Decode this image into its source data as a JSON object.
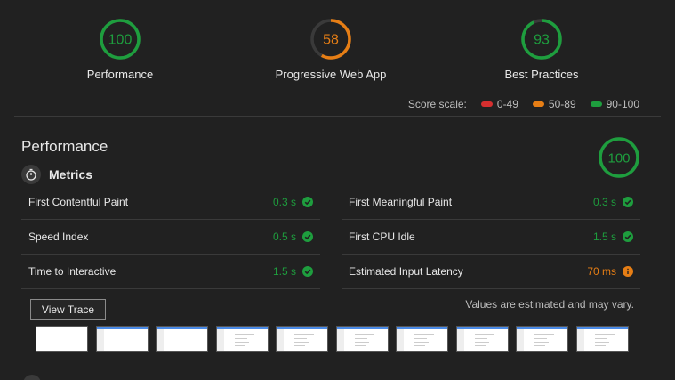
{
  "colors": {
    "pass": "#1e9e3e",
    "average": "#e67e15",
    "fail": "#d62f2f",
    "track": "#3a3a3a"
  },
  "gauges": [
    {
      "score": "100",
      "label": "Performance",
      "fraction": 1.0,
      "color": "#1e9e3e"
    },
    {
      "score": "58",
      "label": "Progressive Web App",
      "fraction": 0.58,
      "color": "#e67e15"
    },
    {
      "score": "93",
      "label": "Best Practices",
      "fraction": 0.93,
      "color": "#1e9e3e"
    }
  ],
  "scale": {
    "label": "Score scale:",
    "ranges": [
      {
        "text": "0-49",
        "color": "#d62f2f"
      },
      {
        "text": "50-89",
        "color": "#e67e15"
      },
      {
        "text": "90-100",
        "color": "#1e9e3e"
      }
    ]
  },
  "performance": {
    "title": "Performance",
    "score": "100",
    "fraction": 1.0
  },
  "metrics": {
    "title": "Metrics",
    "icon": "stopwatch-icon",
    "items": [
      {
        "label": "First Contentful Paint",
        "value": "0.3 s",
        "status": "pass"
      },
      {
        "label": "First Meaningful Paint",
        "value": "0.3 s",
        "status": "pass"
      },
      {
        "label": "Speed Index",
        "value": "0.5 s",
        "status": "pass"
      },
      {
        "label": "First CPU Idle",
        "value": "1.5 s",
        "status": "pass"
      },
      {
        "label": "Time to Interactive",
        "value": "1.5 s",
        "status": "pass"
      },
      {
        "label": "Estimated Input Latency",
        "value": "70 ms",
        "status": "average"
      }
    ]
  },
  "trace": {
    "button_label": "View Trace",
    "note": "Values are estimated and may vary."
  },
  "filmstrip": {
    "frames": 10,
    "blank_frames": 1
  }
}
